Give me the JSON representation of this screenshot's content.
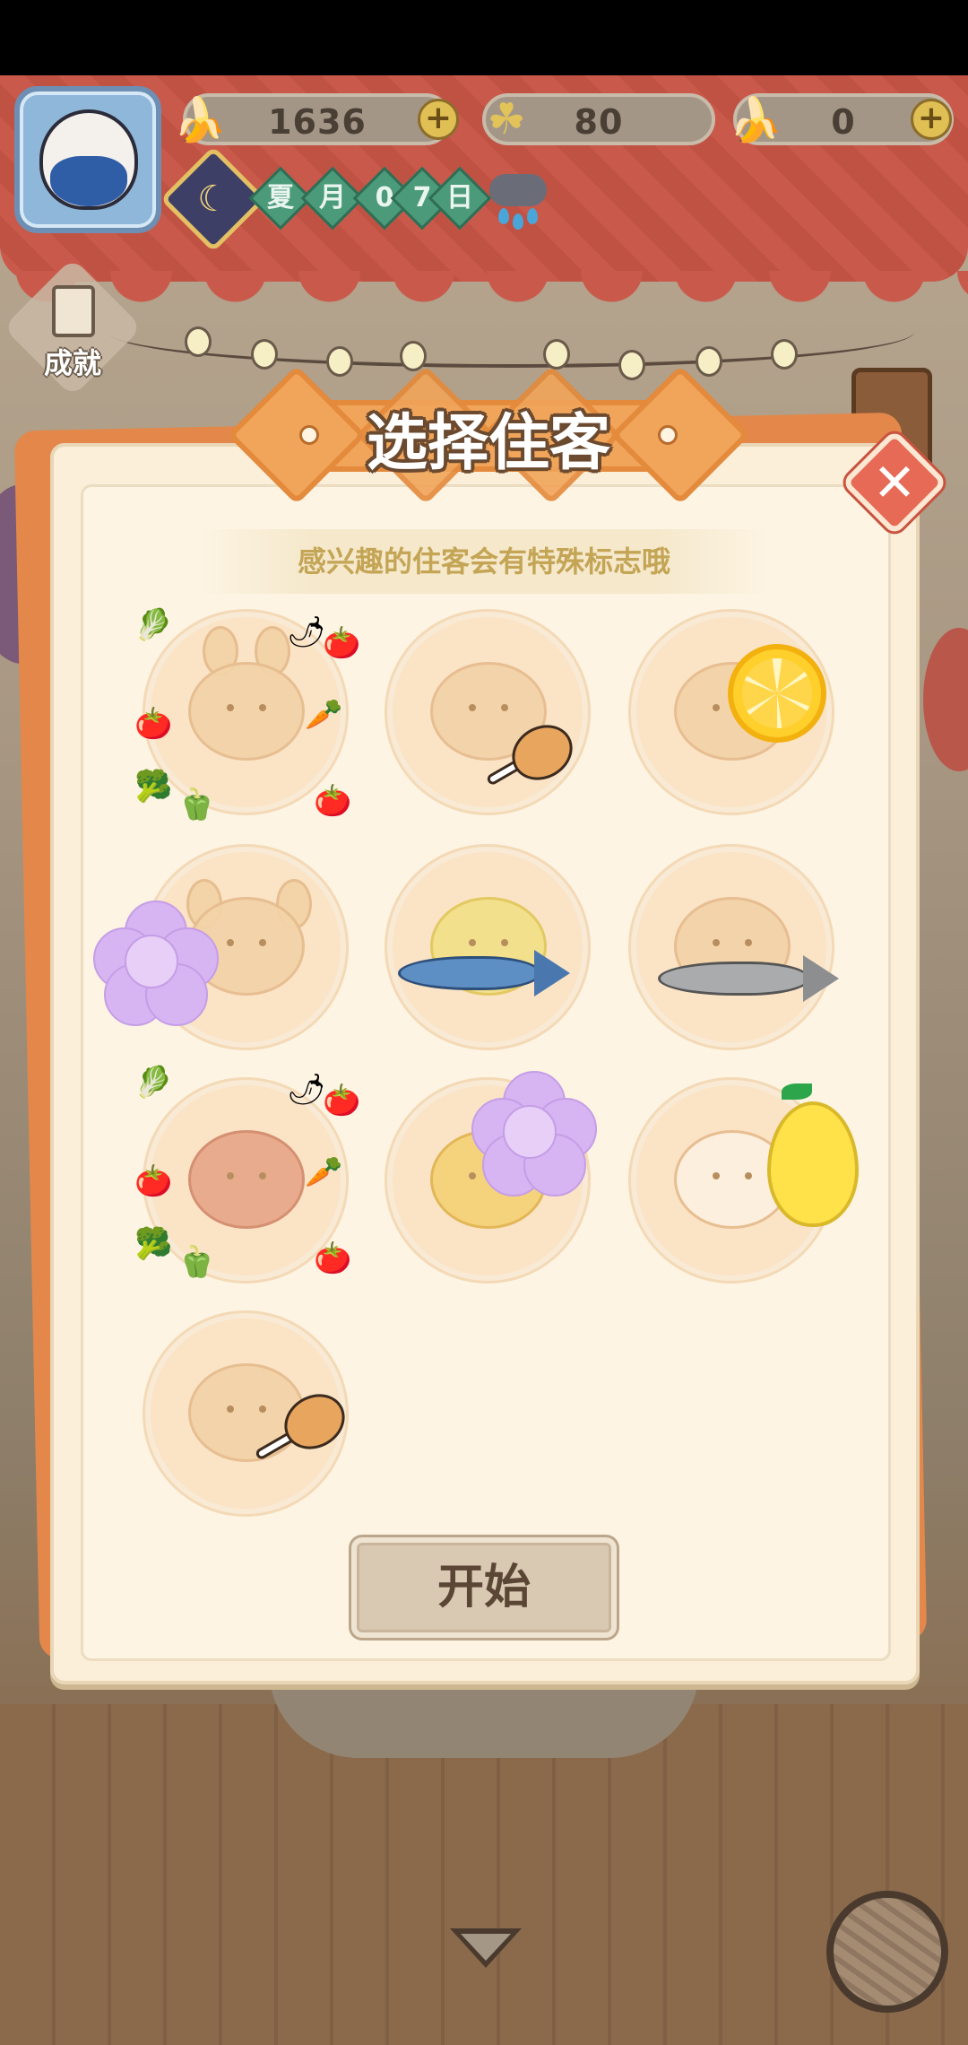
{
  "hud": {
    "bananas": "1636",
    "clovers": "80",
    "blue_bananas": "0",
    "plus": "+",
    "date_chars": [
      "夏",
      "月",
      "0",
      "7",
      "日"
    ],
    "achievement_label": "成就"
  },
  "dialog": {
    "title": "选择住客",
    "hint": "感兴趣的住客会有特殊标志哦",
    "close": "✕",
    "start_label": "开始"
  },
  "guests": [
    {
      "sticker": "vegetable-frame"
    },
    {
      "sticker": "meat"
    },
    {
      "sticker": "lemon-slice"
    },
    {
      "sticker": "flower"
    },
    {
      "sticker": "mackerel"
    },
    {
      "sticker": "sardine"
    },
    {
      "sticker": "vegetable-frame"
    },
    {
      "sticker": "flower"
    },
    {
      "sticker": "lemon-character"
    },
    {
      "sticker": "meat"
    }
  ],
  "colors": {
    "dialog_bg": "#fbefd9",
    "banner": "#f1a55a",
    "close": "#e66a55",
    "hint_text": "#c4a555",
    "guest_circle": "#fbe3c6"
  }
}
